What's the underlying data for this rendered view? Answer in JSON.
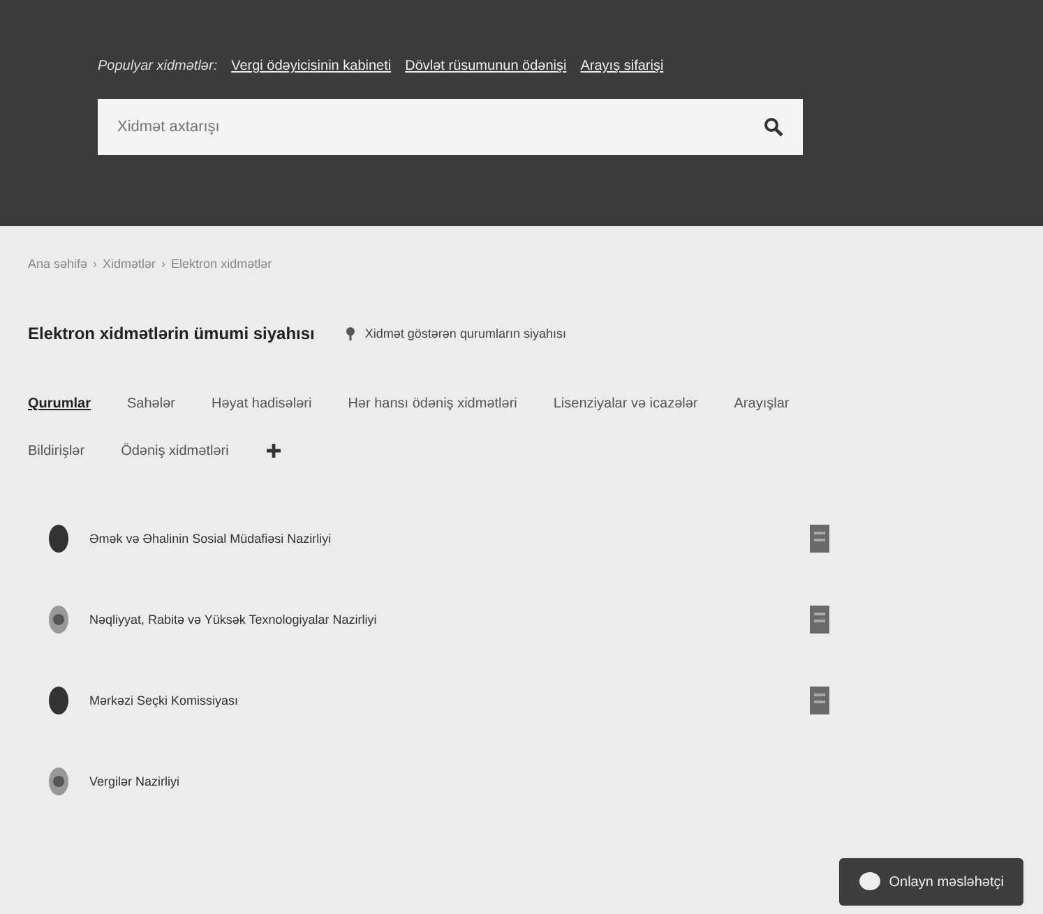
{
  "header": {
    "popular_label": "Populyar xidmətlər:",
    "popular_links": [
      "Vergi ödəyicisinin kabineti",
      "Dövlət rüsumunun ödənişi",
      "Arayış sifarişi"
    ],
    "search": {
      "placeholder": "Xidmət axtarışı"
    }
  },
  "breadcrumb": {
    "separator": "›",
    "items": [
      "Ana səhifə",
      "Xidmətlər",
      "Elektron xidmətlər"
    ]
  },
  "page_title": "Elektron xidmətlərin ümumi siyahısı",
  "title_link": "Xidmət göstərən qurumların siyahısı",
  "tabs": [
    {
      "label": "Qurumlar",
      "selected": true
    },
    {
      "label": "Sahələr",
      "selected": false
    },
    {
      "label": "Həyat hadisələri",
      "selected": false
    },
    {
      "label": "Hər hansı ödəniş xidmətləri",
      "selected": false
    },
    {
      "label": "Lisenziyalar və icazələr",
      "selected": false
    },
    {
      "label": "Arayışlar",
      "selected": false
    },
    {
      "label": "Bildirişlər",
      "selected": false
    },
    {
      "label": "Ödəniş xidmətləri",
      "selected": false
    }
  ],
  "agencies": [
    {
      "name": "Əmək və Əhalinin Sosial Müdafiəsi Nazirliyi",
      "doc_icon": true
    },
    {
      "name": "Nəqliyyat, Rabitə və Yüksək Texnologiyalar Nazirliyi",
      "doc_icon": true
    },
    {
      "name": "Mərkəzi Seçki Komissiyası",
      "doc_icon": true
    },
    {
      "name": "Vergilər Nazirliyi",
      "doc_icon": false
    }
  ],
  "chat_button": "Onlayn məsləhətçi"
}
